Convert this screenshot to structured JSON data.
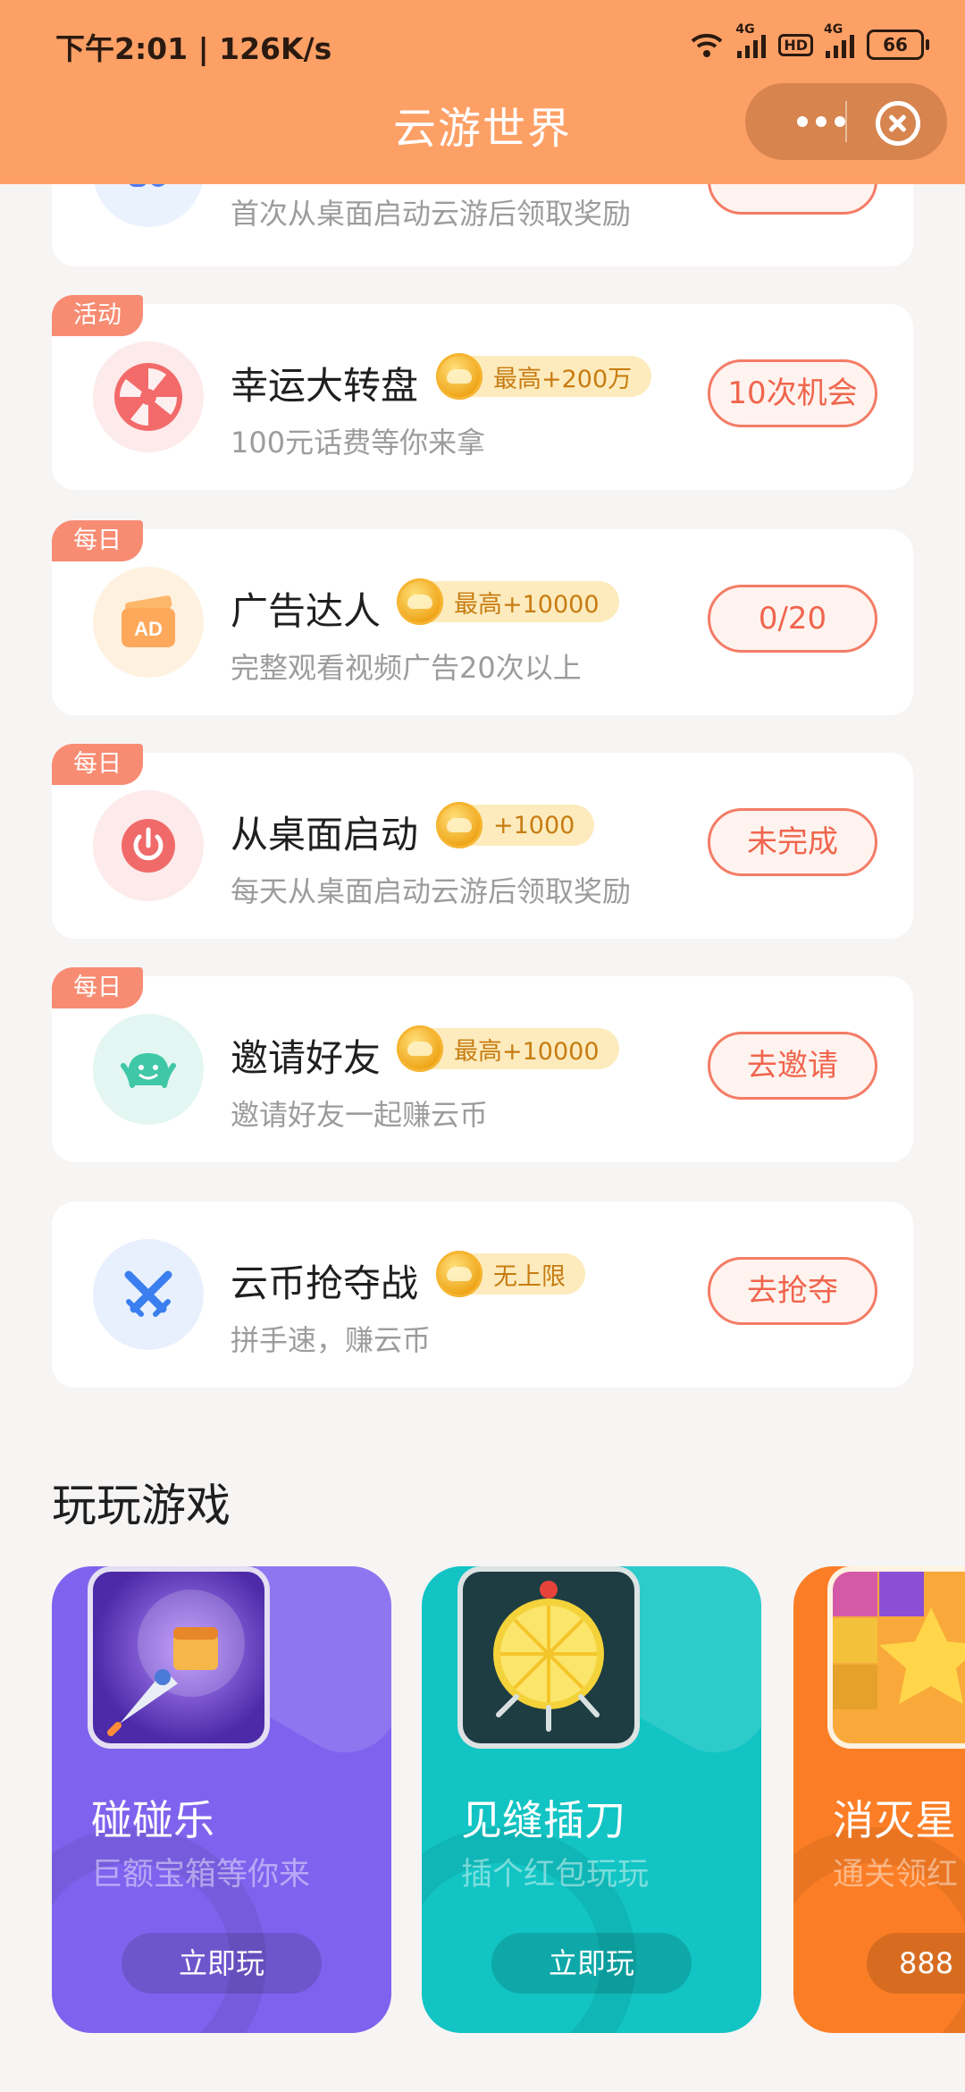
{
  "status_bar": {
    "time": "下午2:01 | 126K/s",
    "network_1": "4G",
    "hd": "HD",
    "network_2": "4G",
    "battery": "66"
  },
  "header": {
    "title": "云游世界"
  },
  "colors": {
    "header": "#fda066",
    "accent": "#f47c66",
    "reward_bg": "#fdebbd"
  },
  "tasks": [
    {
      "tag": "",
      "icon": "desktop-launch-icon",
      "title": "",
      "reward": "",
      "subtitle": "首次从桌面启动云游后领取奖励",
      "action": ""
    },
    {
      "tag": "活动",
      "icon": "lucky-wheel-icon",
      "title": "幸运大转盘",
      "reward": "最高+200万",
      "subtitle": "100元话费等你来拿",
      "action": "10次机会"
    },
    {
      "tag": "每日",
      "icon": "ad-icon",
      "title": "广告达人",
      "reward": "最高+10000",
      "subtitle": "完整观看视频广告20次以上",
      "action": "0/20"
    },
    {
      "tag": "每日",
      "icon": "power-icon",
      "title": "从桌面启动",
      "reward": "+1000",
      "subtitle": "每天从桌面启动云游后领取奖励",
      "action": "未完成"
    },
    {
      "tag": "每日",
      "icon": "invite-friend-icon",
      "title": "邀请好友",
      "reward": "最高+10000",
      "subtitle": "邀请好友一起赚云币",
      "action": "去邀请"
    },
    {
      "tag": "",
      "icon": "crossed-swords-icon",
      "title": "云币抢夺战",
      "reward": "无上限",
      "subtitle": "拼手速，赚云币",
      "action": "去抢夺"
    }
  ],
  "games_section": {
    "title": "玩玩游戏",
    "games": [
      {
        "name": "碰碰乐",
        "subtitle": "巨额宝箱等你来",
        "button": "立即玩",
        "color": "#7f63ee"
      },
      {
        "name": "见缝插刀",
        "subtitle": "插个红包玩玩",
        "button": "立即玩",
        "color": "#12c4c4"
      },
      {
        "name": "消灭星",
        "subtitle": "通关领红",
        "button": "888",
        "color": "#fb7e26"
      }
    ]
  }
}
